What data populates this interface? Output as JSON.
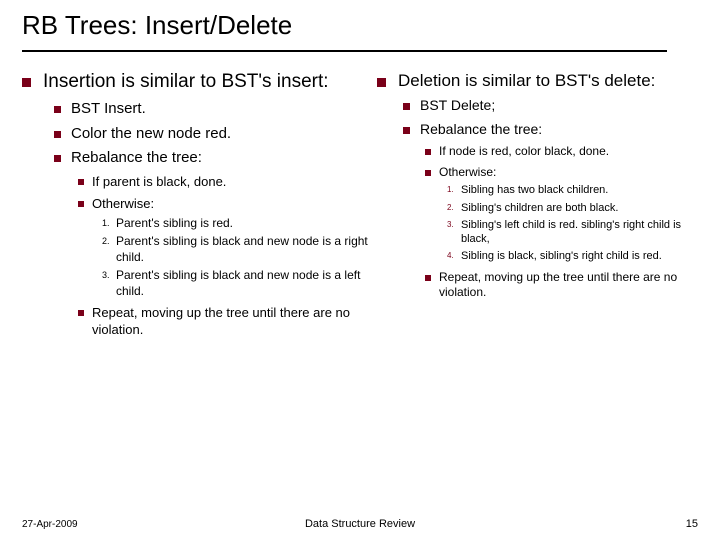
{
  "title": "RB Trees: Insert/Delete",
  "footer": {
    "left": "27-Apr-2009",
    "center": "Data Structure Review",
    "right": "15"
  },
  "left": {
    "h": "Insertion is similar to BST's insert:",
    "b1": "BST Insert.",
    "b2": "Color the new node red.",
    "b3": "Rebalance the tree:",
    "c1": "If parent is black, done.",
    "c2": "Otherwise:",
    "n1": "Parent's sibling is red.",
    "n2": "Parent's sibling is black and new node is a right child.",
    "n3": "Parent's sibling is black and new node is a left child.",
    "c3": "Repeat, moving up the tree until there are no violation."
  },
  "right": {
    "h": "Deletion is similar to BST's delete:",
    "b1": "BST Delete;",
    "b2": "Rebalance the tree:",
    "c1": "If node is red, color black, done.",
    "c2": "Otherwise:",
    "n1": "Sibling has two black children.",
    "n2": "Sibling's children are both black.",
    "n3": "Sibling's left child is red. sibling's right child is black,",
    "n4": "Sibling is black, sibling's right child is red.",
    "c3": "Repeat, moving up the tree until there are no violation."
  },
  "labels": {
    "l1": "1.",
    "l2": "2.",
    "l3": "3.",
    "l4": "4."
  }
}
